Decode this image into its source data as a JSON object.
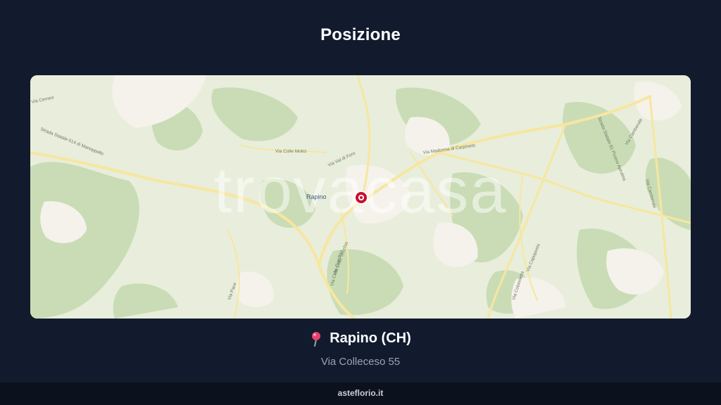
{
  "header": {
    "title": "Posizione"
  },
  "map": {
    "watermark": "trovacasa",
    "place_label": "Rapino",
    "road_labels": {
      "via_cerrani": "Via Cerrani",
      "ss614": "Strada Statale 614 di Manoppello",
      "via_colle_molici": "Via Colle Molici",
      "via_val_di_foro": "Via Val di Foro",
      "via_madonna": "Via Madonna di Carpineto",
      "via_camberale_top": "Via Camberale",
      "ss_nord": "Strada Statale 81 Piceno Aprutina",
      "via_camberale_right": "Via Camberale",
      "via_colle_vecchio": "Via Colle Vecchio",
      "via_colle_giardino": "Via Colle Giardino",
      "via_capoposto": "Via Capoposto",
      "via_colonnetta": "Via Colonnetta",
      "via_pace": "Via Pace"
    },
    "marker_icon": "location-marker-icon",
    "colors": {
      "land": "#e9efdc",
      "forest": "#c9dcb4",
      "urban": "#f4f1ea",
      "road": "#f6e7a3",
      "marker": "#c8102e"
    }
  },
  "location": {
    "pin_icon": "round-pushpin-icon",
    "title": "Rapino (CH)",
    "address": "Via Colleceso 55"
  },
  "footer": {
    "brand": "asteflorio.it"
  }
}
